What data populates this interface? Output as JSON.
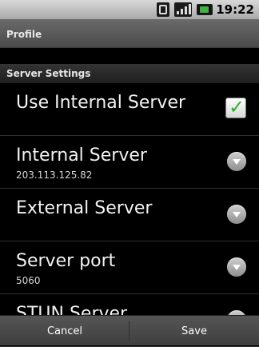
{
  "status_bar": {
    "time": "19:22",
    "icons": [
      "wifi-icon",
      "signal-icon",
      "battery-icon"
    ]
  },
  "header": {
    "title": "Profile"
  },
  "section": {
    "title": "Server Settings"
  },
  "settings": [
    {
      "label": "Use Internal Server",
      "value": "",
      "control": "checkbox",
      "checked": true
    },
    {
      "label": "Internal Server",
      "value": "203.113.125.82",
      "control": "dropdown"
    },
    {
      "label": "External Server",
      "value": "",
      "control": "dropdown"
    },
    {
      "label": "Server port",
      "value": "5060",
      "control": "dropdown"
    },
    {
      "label": "STUN Server",
      "value": "",
      "control": "dropdown"
    }
  ],
  "footer": {
    "cancel_label": "Cancel",
    "save_label": "Save"
  },
  "colors": {
    "checkbox_check": "#30b330",
    "battery_green": "#3fb340"
  }
}
